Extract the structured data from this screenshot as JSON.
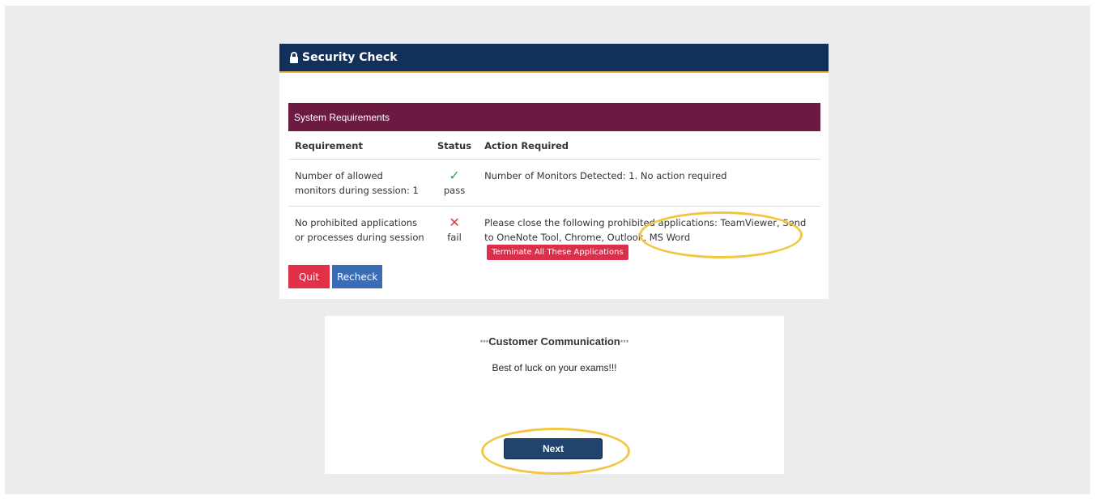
{
  "header": {
    "title": "Security Check",
    "icon": "lock-icon"
  },
  "requirements": {
    "panel_title": "System Requirements",
    "columns": [
      "Requirement",
      "Status",
      "Action Required"
    ],
    "rows": [
      {
        "requirement": "Number of allowed monitors during session: 1",
        "status": "pass",
        "status_icon": "check-icon",
        "action": "Number of Monitors Detected: 1. No action required"
      },
      {
        "requirement": "No prohibited applications or processes during session",
        "status": "fail",
        "status_icon": "cross-icon",
        "action": "Please close the following prohibited applications: TeamViewer, Send to OneNote Tool, Chrome, Outlook, MS Word",
        "action_button": "Terminate All These Applications"
      }
    ]
  },
  "buttons": {
    "quit": "Quit",
    "recheck": "Recheck",
    "next": "Next"
  },
  "communication": {
    "stars": "***",
    "title": "Customer Communication",
    "message": "Best of luck on your exams!!!"
  },
  "colors": {
    "header_bg": "#12305a",
    "panel_bg": "#6d1a43",
    "pass": "#2fa84f",
    "fail": "#d63a3a",
    "highlight": "#f4c542"
  }
}
